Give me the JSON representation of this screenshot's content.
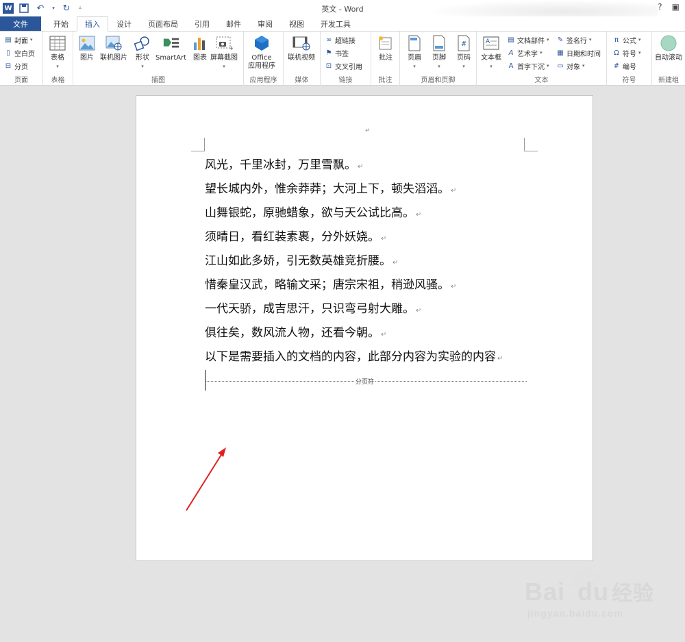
{
  "window": {
    "title": "英文 - Word",
    "help": "?",
    "app_icon": "W"
  },
  "tabs": [
    {
      "label": "文件"
    },
    {
      "label": "开始"
    },
    {
      "label": "插入"
    },
    {
      "label": "设计"
    },
    {
      "label": "页面布局"
    },
    {
      "label": "引用"
    },
    {
      "label": "邮件"
    },
    {
      "label": "审阅"
    },
    {
      "label": "视图"
    },
    {
      "label": "开发工具"
    }
  ],
  "ribbon": {
    "pages": {
      "label": "页面",
      "cover": "封面",
      "blank": "空白页",
      "break": "分页"
    },
    "tables": {
      "label": "表格",
      "table": "表格"
    },
    "illustrations": {
      "label": "插图",
      "picture": "图片",
      "online_picture": "联机图片",
      "shapes": "形状",
      "smartart": "SmartArt",
      "chart": "图表",
      "screenshot": "屏幕截图"
    },
    "apps": {
      "label": "应用程序",
      "office_line1": "Office",
      "office_line2": "应用程序"
    },
    "media": {
      "label": "媒体",
      "online_video": "联机视频"
    },
    "links": {
      "label": "链接",
      "hyperlink": "超链接",
      "bookmark": "书签",
      "cross_ref": "交叉引用"
    },
    "comments": {
      "label": "批注",
      "comment": "批注"
    },
    "header_footer": {
      "label": "页眉和页脚",
      "header": "页眉",
      "footer": "页脚",
      "page_number": "页码"
    },
    "text": {
      "label": "文本",
      "textbox": "文本框",
      "quick_parts": "文档部件",
      "wordart": "艺术字",
      "dropcap": "首字下沉",
      "signature": "签名行",
      "datetime": "日期和时间",
      "object": "对象"
    },
    "symbols": {
      "label": "符号",
      "equation": "公式",
      "symbol": "符号",
      "number": "编号"
    },
    "new_group": {
      "label": "新建组",
      "autoscroll": "自动滚动"
    }
  },
  "document": {
    "header_mark": "↵",
    "lines": [
      "风光，千里冰封，万里雪飘。",
      "望长城内外，惟余莽莽；大河上下，顿失滔滔。",
      "山舞银蛇，原驰蜡象，欲与天公试比高。",
      "须晴日，看红装素裹，分外妖娆。",
      "江山如此多娇，引无数英雄竞折腰。",
      "惜秦皇汉武，略输文采；唐宗宋祖，稍逊风骚。",
      "一代天骄，成吉思汗，只识弯弓射大雕。",
      "俱往矣，数风流人物，还看今朝。",
      "以下是需要插入的文档的内容，此部分内容为实验的内容"
    ],
    "paragraph_mark": "↵",
    "page_break_label": "分页符"
  },
  "watermark": {
    "brand": "Bai",
    "brand_du": "du",
    "cn": "经验",
    "url": "jingyan.baidu.com"
  },
  "colors": {
    "accent": "#2b579a",
    "arrow": "#e02020"
  }
}
